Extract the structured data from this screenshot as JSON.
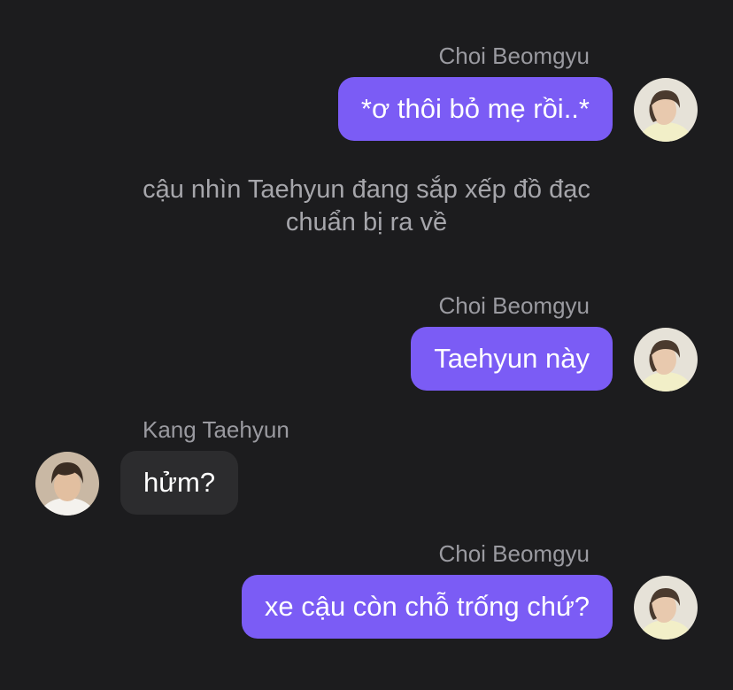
{
  "messages": [
    {
      "sender": "Choi Beomgyu",
      "text": "*ơ thôi bỏ mẹ rồi..*"
    },
    {
      "sender": "Choi Beomgyu",
      "text": "Taehyun này"
    },
    {
      "sender": "Kang Taehyun",
      "text": "hửm?"
    },
    {
      "sender": "Choi Beomgyu",
      "text": "xe cậu còn chỗ trống chứ?"
    }
  ],
  "narration": {
    "line1": "cậu nhìn Taehyun đang sắp xếp đồ đạc",
    "line2": "chuẩn bị ra về"
  },
  "colors": {
    "background": "#1c1c1e",
    "outgoing_bubble": "#7b5cf5",
    "incoming_bubble": "#2c2c2e",
    "sender_text": "#9a9aa0"
  },
  "icons": {
    "beomgyu_avatar": "avatar-photo",
    "taehyun_avatar": "avatar-photo"
  }
}
